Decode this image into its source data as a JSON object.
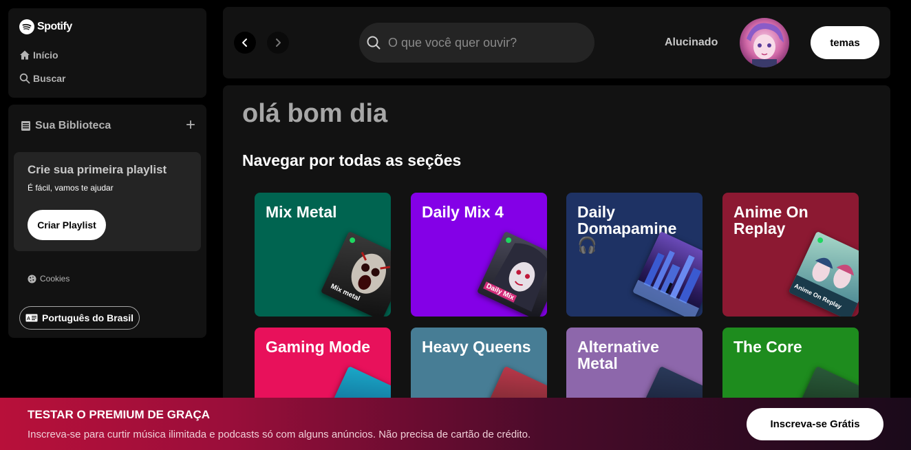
{
  "sidebar": {
    "logo_text": "Spotify",
    "nav": {
      "home": "Início",
      "search": "Buscar"
    },
    "library": {
      "title": "Sua Biblioteca",
      "add_symbol": "+",
      "create_card": {
        "title": "Crie sua primeira playlist",
        "subtitle": "É fácil, vamos te ajudar",
        "button": "Criar Playlist"
      },
      "cookies": "Cookies",
      "language": "Português do Brasil"
    }
  },
  "header": {
    "search_placeholder": "O que você quer ouvir?",
    "username": "Alucinado",
    "themes_button": "temas"
  },
  "main": {
    "greeting": "olá bom dia",
    "section_title": "Navegar por todas as seções",
    "cards": [
      {
        "title": "Mix Metal",
        "color": "#006450",
        "art_label": "Mix metal"
      },
      {
        "title": "Daily Mix 4",
        "color": "#8400e7",
        "art_label": "Daily Mix"
      },
      {
        "title": "Daily Domapamine 🎧",
        "color": "#1e3264",
        "art_label": ""
      },
      {
        "title": "Anime On Replay",
        "color": "#8c1932",
        "art_label": "Anime On Replay"
      },
      {
        "title": "Gaming Mode",
        "color": "#e8115b",
        "art_label": ""
      },
      {
        "title": "Heavy Queens",
        "color": "#477d95",
        "art_label": ""
      },
      {
        "title": "Alternative Metal",
        "color": "#8d67ab",
        "art_label": ""
      },
      {
        "title": "The Core",
        "color": "#1e8c1e",
        "art_label": ""
      }
    ]
  },
  "banner": {
    "title": "TESTAR O PREMIUM DE GRAÇA",
    "subtitle": "Inscreva-se para curtir música ilimitada e podcasts só com alguns anúncios. Não precisa de cartão de crédito.",
    "button": "Inscreva-se Grátis"
  }
}
